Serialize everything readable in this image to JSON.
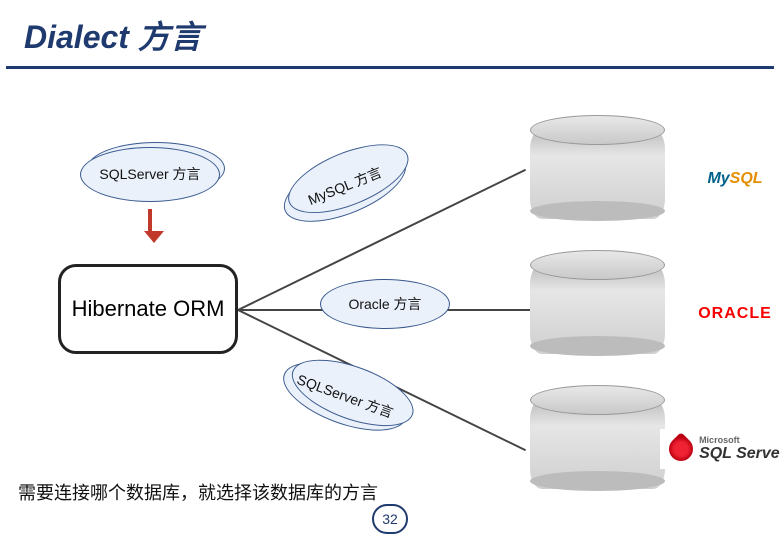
{
  "title": "Dialect 方言",
  "badges": {
    "sqlserver_top": "SQLServer 方言",
    "mysql": "MySQL 方言",
    "oracle": "Oracle 方言",
    "sqlserver_bottom": "SQLServer 方言"
  },
  "hibernate": "Hibernate ORM",
  "logos": {
    "mysql_part1": "My",
    "mysql_part2": "SQL",
    "oracle": "ORACLE",
    "sqlserver_vendor": "Microsoft",
    "sqlserver_name": "SQL Server"
  },
  "bottom_note": "需要连接哪个数据库，就选择该数据库的方言",
  "page_number": "32"
}
